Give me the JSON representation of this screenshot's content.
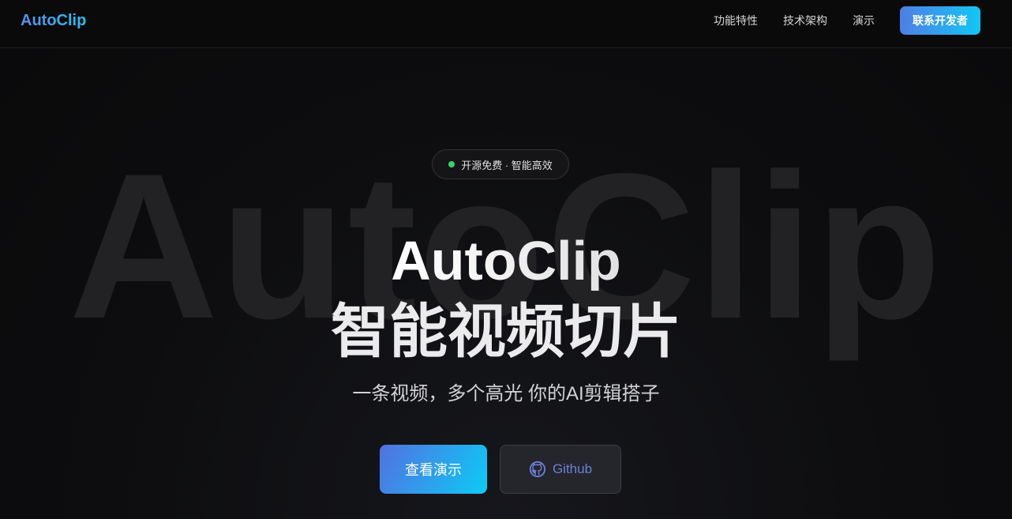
{
  "nav": {
    "logo": "AutoClip",
    "links": [
      "功能特性",
      "技术架构",
      "演示"
    ],
    "contact_label": "联系开发者"
  },
  "hero": {
    "watermark": "AutoClip",
    "badge": "开源免费 · 智能高效",
    "title": "AutoClip",
    "subtitle": "智能视频切片",
    "tagline": "一条视频，多个高光 你的AI剪辑搭子",
    "demo_label": "查看演示",
    "github_label": "Github"
  },
  "colors": {
    "accent_start": "#4f7ee5",
    "accent_end": "#12c6f5",
    "badge_dot": "#35d36b",
    "github_text": "#6d7fd9"
  },
  "icons": {
    "github": "github-icon",
    "badge_dot": "status-dot-icon"
  }
}
